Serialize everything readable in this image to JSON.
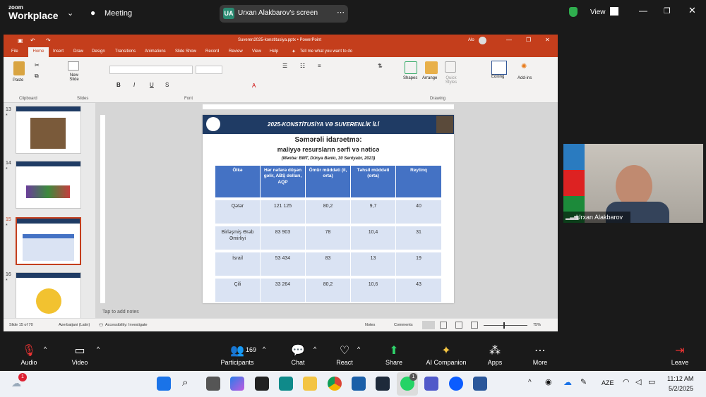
{
  "zoom": {
    "logo_top": "zoom",
    "logo_bottom": "Workplace",
    "meeting_label": "Meeting",
    "share_badge": "UA",
    "share_title": "Urxan Alakbarov's screen",
    "view_label": "View"
  },
  "ppt": {
    "title": "Suveren2025-konstitusiya.pptx  •  PowerPoint",
    "user_initials": "Alo",
    "tabs": [
      "File",
      "Home",
      "Insert",
      "Draw",
      "Design",
      "Transitions",
      "Animations",
      "Slide Show",
      "Record",
      "Review",
      "View",
      "Help"
    ],
    "tell_me": "Tell me what you want to do",
    "ribbon_groups": {
      "paste": "Paste",
      "clipboard": "Clipboard",
      "new_slide": "New Slide",
      "slides": "Slides",
      "font": "Font",
      "shapes": "Shapes",
      "arrange": "Arrange",
      "quick_styles": "Quick Styles",
      "drawing": "Drawing",
      "editing": "Editing",
      "addins": "Add-ins"
    },
    "thumbnails": [
      {
        "num": "13",
        "star": "*"
      },
      {
        "num": "14",
        "star": "*"
      },
      {
        "num": "15",
        "star": "*"
      },
      {
        "num": "16",
        "star": "*"
      }
    ],
    "slide": {
      "header": "2025-KONSTİTUSİYA VƏ SUVERENLİK İLİ",
      "title1": "Səmərəli idarəetmə:",
      "title2": "maliyyə resursların sərfi və nəticə",
      "source": "(Mənbə: BMT, Dünya Bankı, 30 Sentyabr, 2023)",
      "columns": [
        "Ölkə",
        "Hər nəfərə düşən gəlir, ABŞ dolları, AQP",
        "Ömür müddəti (il, orta)",
        "Təhsil müddəti (orta)",
        "Reytinq"
      ],
      "rows": [
        [
          "Qətər",
          "121 125",
          "80,2",
          "9,7",
          "40"
        ],
        [
          "Birləşmiş Ərəb Əmirliyi",
          "83 903",
          "78",
          "10,4",
          "31"
        ],
        [
          "İsrail",
          "53 434",
          "83",
          "13",
          "19"
        ],
        [
          "Çili",
          "33 264",
          "80,2",
          "10,6",
          "43"
        ]
      ]
    },
    "notes_placeholder": "Tap to add notes",
    "status": {
      "slide_count": "Slide 15 of 70",
      "language": "Azerbaijani (Latin)",
      "accessibility": "Accessibility: Investigate",
      "notes": "Notes",
      "comments": "Comments",
      "zoom": "75%"
    }
  },
  "participant": {
    "name": "Urxan Alakbarov"
  },
  "controls": {
    "audio": "Audio",
    "video": "Video",
    "participants": "Participants",
    "participants_count": "169",
    "chat": "Chat",
    "react": "React",
    "share": "Share",
    "ai": "AI Companion",
    "apps": "Apps",
    "more": "More",
    "leave": "Leave"
  },
  "taskbar": {
    "lang": "AZE",
    "time": "11:12 AM",
    "date": "5/2/2025",
    "notif_badge": "1",
    "whatsapp_badge": "1"
  }
}
